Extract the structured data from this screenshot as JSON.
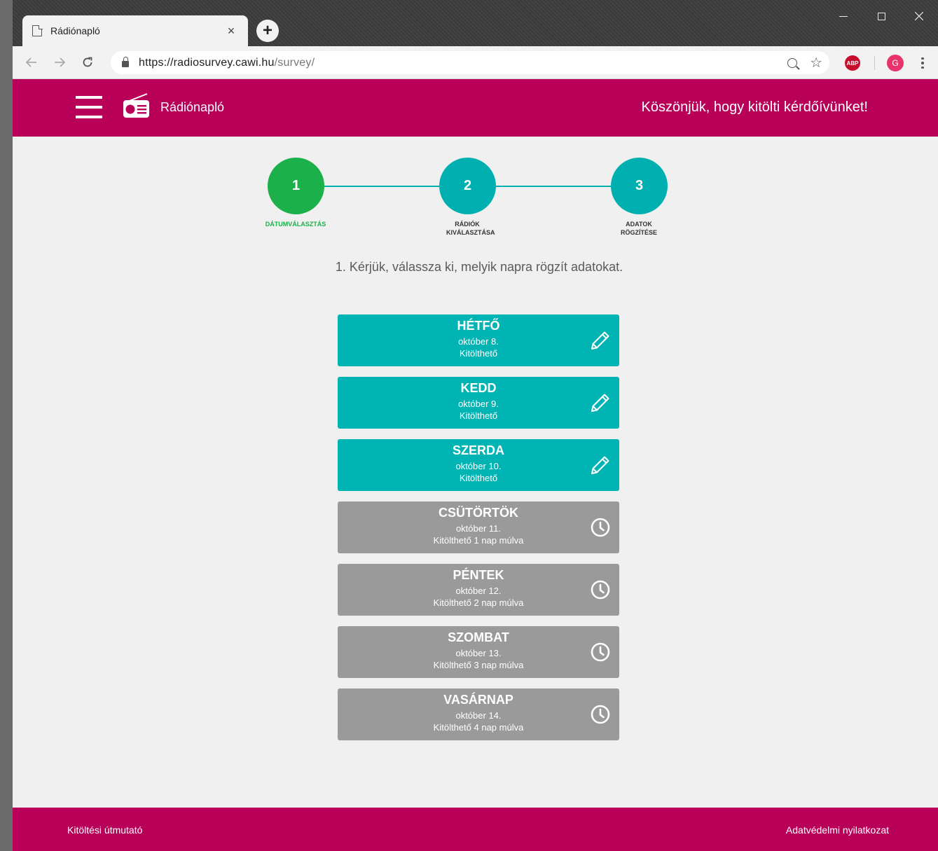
{
  "browser": {
    "tab_title": "Rádiónapló",
    "tab_close": "×",
    "new_tab": "+",
    "url_host": "https://radiosurvey.cawi.hu",
    "url_path": "/survey/",
    "abp": "ABP",
    "profile_initial": "G"
  },
  "header": {
    "brand": "Rádiónapló",
    "message": "Köszönjük, hogy kitölti kérdőívünket!"
  },
  "steps": [
    {
      "number": "1",
      "label": "DÁTUMVÁLASZTÁS",
      "active": true
    },
    {
      "number": "2",
      "label": "RÁDIÓK KIVÁLASZTÁSA",
      "active": false
    },
    {
      "number": "3",
      "label": "ADATOK RÖGZÍTÉSE",
      "active": false
    }
  ],
  "instruction": "1. Kérjük, válassza ki, melyik napra rögzít adatokat.",
  "days": [
    {
      "name": "HÉTFŐ",
      "date": "október 8.",
      "status": "Kitölthető",
      "state": "open"
    },
    {
      "name": "KEDD",
      "date": "október 9.",
      "status": "Kitölthető",
      "state": "open"
    },
    {
      "name": "SZERDA",
      "date": "október 10.",
      "status": "Kitölthető",
      "state": "open"
    },
    {
      "name": "CSÜTÖRTÖK",
      "date": "október 11.",
      "status": "Kitölthető 1 nap múlva",
      "state": "locked"
    },
    {
      "name": "PÉNTEK",
      "date": "október 12.",
      "status": "Kitölthető 2 nap múlva",
      "state": "locked"
    },
    {
      "name": "SZOMBAT",
      "date": "október 13.",
      "status": "Kitölthető 3 nap múlva",
      "state": "locked"
    },
    {
      "name": "VASÁRNAP",
      "date": "október 14.",
      "status": "Kitölthető 4 nap múlva",
      "state": "locked"
    }
  ],
  "footer": {
    "guide": "Kitöltési útmutató",
    "privacy": "Adatvédelmi nyilatkozat"
  },
  "colors": {
    "brand": "#b80059",
    "teal": "#00b4b4",
    "active_step": "#1bb04a",
    "locked": "#9a9a9a"
  },
  "icons": {
    "open_day": "pencil-icon",
    "locked_day": "clock-icon"
  }
}
